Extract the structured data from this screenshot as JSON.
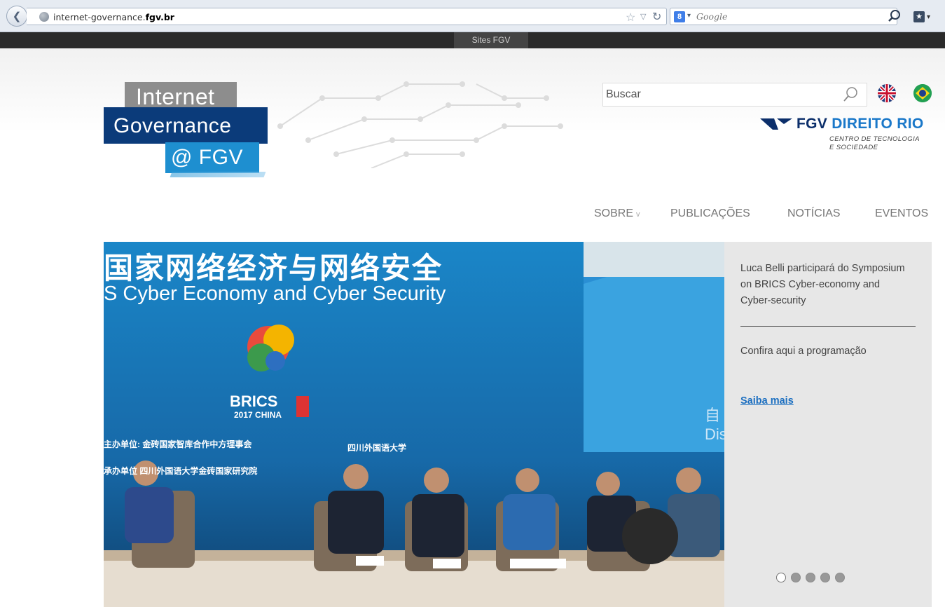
{
  "browser": {
    "url_prefix": "internet-governance.",
    "url_domain": "fgv.br",
    "search_placeholder": "Google",
    "search_engine_badge": "8"
  },
  "topbar": {
    "sites_label": "Sites FGV"
  },
  "header": {
    "logo_line1": "Internet",
    "logo_line2": "Governance",
    "logo_line3": "@ FGV",
    "search_placeholder": "Buscar",
    "fgv_brand": "FGV",
    "fgv_direito": "DIREITO",
    "fgv_rio": "RIO",
    "fgv_sub1": "CENTRO DE TECNOLOGIA",
    "fgv_sub2": "E SOCIEDADE"
  },
  "nav": {
    "items": [
      {
        "label": "SOBRE",
        "has_dropdown": true
      },
      {
        "label": "PUBLICAÇÕES"
      },
      {
        "label": "NOTÍCIAS"
      },
      {
        "label": "EVENTOS"
      }
    ]
  },
  "slider": {
    "photo": {
      "banner_cn": "国家网络经济与网络安全",
      "banner_en": "S Cyber Economy and Cyber Security",
      "brics": "BRICS",
      "brics_sub": "2017 CHINA",
      "host1": "主办单位: 金砖国家智库合作中方理事会",
      "host2": "承办单位 四川外国语大学金砖国家研究院",
      "uni": "四川外国语大学",
      "side": "自 Dis"
    },
    "panel": {
      "headline": "Luca Belli participará do Symposium on BRICS Cyber-economy and Cyber-security",
      "body": "Confira aqui a programação",
      "link": "Saiba mais"
    },
    "slide_count": 5,
    "active_slide": 1
  },
  "colors": {
    "topbar": "#2a2a2a",
    "logo_gray": "#8d8d8d",
    "logo_navy": "#0b3b7a",
    "logo_blue": "#1e8fd0",
    "link": "#1c6fc0",
    "panel_bg": "#e7e7e7"
  }
}
